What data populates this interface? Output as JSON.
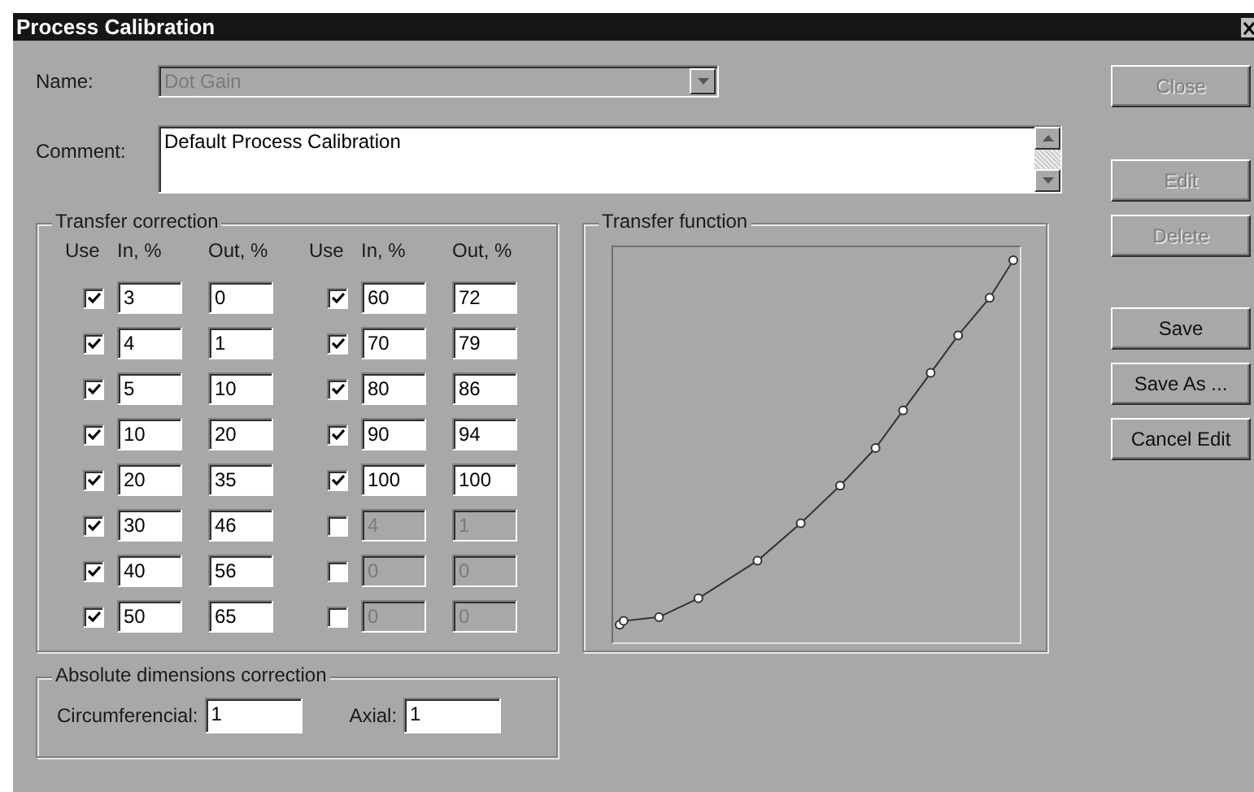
{
  "window": {
    "title": "Process Calibration"
  },
  "name_field": {
    "label": "Name:",
    "value": "Dot Gain",
    "disabled": true
  },
  "comment_field": {
    "label": "Comment:",
    "value": "Default Process Calibration"
  },
  "transfer_correction": {
    "title": "Transfer correction",
    "sets": [
      {
        "headers": [
          "Use",
          "In, %",
          "Out, %"
        ],
        "rows": [
          {
            "use": true,
            "in": "3",
            "out": "0"
          },
          {
            "use": true,
            "in": "4",
            "out": "1"
          },
          {
            "use": true,
            "in": "5",
            "out": "10"
          },
          {
            "use": true,
            "in": "10",
            "out": "20"
          },
          {
            "use": true,
            "in": "20",
            "out": "35"
          },
          {
            "use": true,
            "in": "30",
            "out": "46"
          },
          {
            "use": true,
            "in": "40",
            "out": "56"
          },
          {
            "use": true,
            "in": "50",
            "out": "65"
          }
        ]
      },
      {
        "headers": [
          "Use",
          "In, %",
          "Out, %"
        ],
        "rows": [
          {
            "use": true,
            "in": "60",
            "out": "72"
          },
          {
            "use": true,
            "in": "70",
            "out": "79"
          },
          {
            "use": true,
            "in": "80",
            "out": "86"
          },
          {
            "use": true,
            "in": "90",
            "out": "94"
          },
          {
            "use": true,
            "in": "100",
            "out": "100"
          },
          {
            "use": false,
            "in": "4",
            "out": "1"
          },
          {
            "use": false,
            "in": "0",
            "out": "0"
          },
          {
            "use": false,
            "in": "0",
            "out": "0"
          }
        ]
      }
    ]
  },
  "transfer_function": {
    "title": "Transfer function"
  },
  "absolute_correction": {
    "title": "Absolute dimensions correction",
    "fields": [
      {
        "label": "Circumferencial:",
        "value": "1"
      },
      {
        "label": "Axial:",
        "value": "1"
      }
    ]
  },
  "button_groups": [
    [
      {
        "label": "Close",
        "disabled": true
      }
    ],
    [
      {
        "label": "Edit",
        "disabled": true
      },
      {
        "label": "Delete",
        "disabled": true
      }
    ],
    [
      {
        "label": "Save",
        "disabled": false
      },
      {
        "label": "Save As ...",
        "disabled": false
      },
      {
        "label": "Cancel Edit",
        "disabled": false
      }
    ]
  ]
}
